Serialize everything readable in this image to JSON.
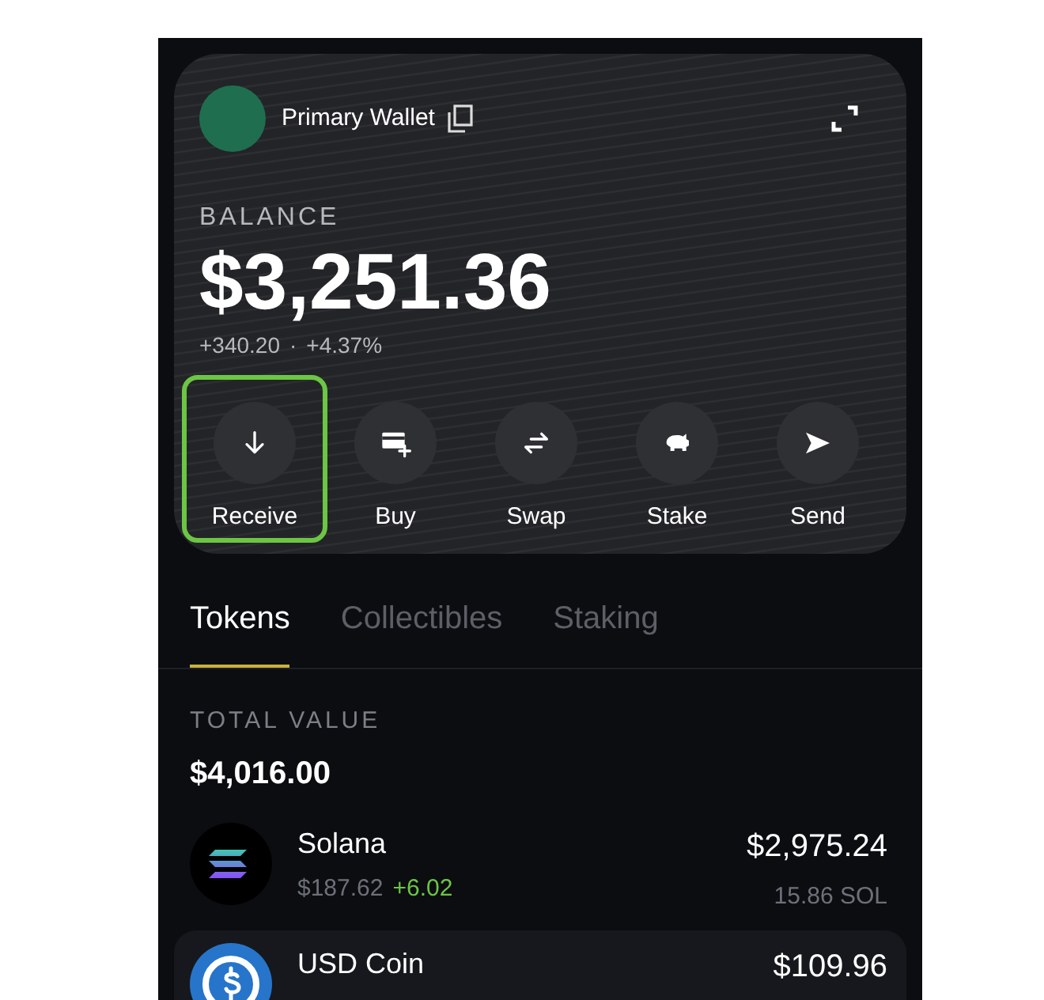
{
  "wallet": {
    "name": "Primary Wallet"
  },
  "balance": {
    "label": "BALANCE",
    "amount": "$3,251.36",
    "change": "+340.20",
    "separator": "·",
    "percent": "+4.37%"
  },
  "actions": [
    {
      "label": "Receive",
      "kind": "receive",
      "selected": true
    },
    {
      "label": "Buy",
      "kind": "buy",
      "selected": false
    },
    {
      "label": "Swap",
      "kind": "swap",
      "selected": false
    },
    {
      "label": "Stake",
      "kind": "stake",
      "selected": false
    },
    {
      "label": "Send",
      "kind": "send",
      "selected": false
    }
  ],
  "tabs": [
    {
      "label": "Tokens",
      "selected": true
    },
    {
      "label": "Collectibles",
      "selected": false
    },
    {
      "label": "Staking",
      "selected": false
    }
  ],
  "total": {
    "label": "TOTAL VALUE",
    "amount": "$4,016.00"
  },
  "tokens": [
    {
      "name": "Solana",
      "kind": "solana",
      "price": "$187.62",
      "change": "+6.02",
      "value": "$2,975.24",
      "amount": "15.86 SOL",
      "selected": false
    },
    {
      "name": "USD Coin",
      "kind": "usdc",
      "value": "$109.96",
      "selected": true
    }
  ]
}
